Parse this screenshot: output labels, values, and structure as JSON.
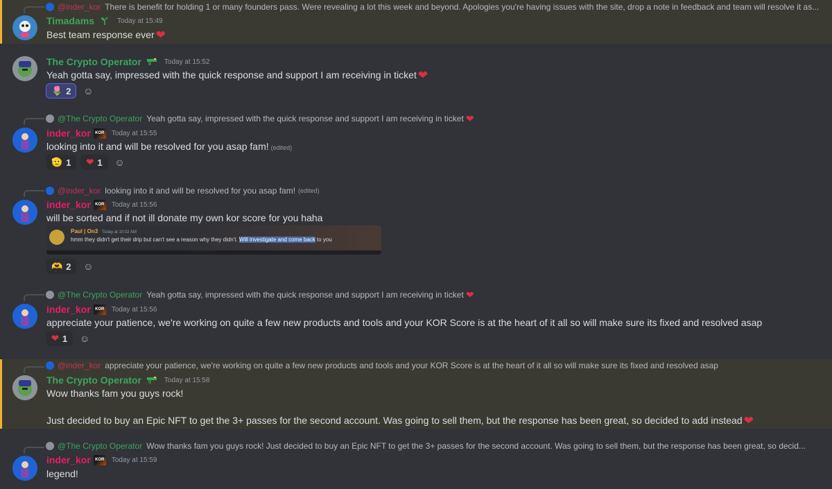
{
  "messages": [
    {
      "reply": {
        "name": "@inder_kor",
        "text": "There is benefit for holding 1 or many founders pass. Were revealing a lot this week and beyond.  Apologies you're having issues with the site, drop a note in feedback and team will resolve it as..."
      },
      "author": "Timadams",
      "timestamp": "Today at 15:49",
      "text": "Best team response ever"
    },
    {
      "author": "The Crypto Operator",
      "timestamp": "Today at 15:52",
      "text": "Yeah gotta say, impressed with the quick response and support I am receiving in ticket",
      "reactions": [
        {
          "emoji": "🌷",
          "count": "2"
        }
      ]
    },
    {
      "reply": {
        "name": "@The Crypto Operator",
        "text": "Yeah gotta say, impressed with the quick response and support I am receiving in ticket"
      },
      "author": "inder_kor",
      "badge": "KOR",
      "timestamp": "Today at 15:55",
      "text": "looking into it and will be resolved for you asap fam!",
      "edited": "(edited)",
      "reactions": [
        {
          "emoji": "🫡",
          "count": "1"
        },
        {
          "emoji": "❤",
          "count": "1"
        }
      ]
    },
    {
      "reply": {
        "name": "@inder_kor",
        "text": "looking into it and will be resolved for you asap fam!",
        "edited": "(edited)"
      },
      "author": "inder_kor",
      "badge": "KOR",
      "timestamp": "Today at 15:56",
      "text": "will be sorted and if not ill donate my own kor score for you haha",
      "embed": {
        "name": "Paul | On3",
        "timestamp": "Today at 10:02 AM",
        "text_plain": "hmm they didn't get their drip but can't see a reason why they didn't. ",
        "text_highlight": "Will investigate and come back",
        "text_end": " to you"
      },
      "reactions": [
        {
          "emoji": "🫶",
          "count": "2"
        }
      ]
    },
    {
      "reply": {
        "name": "@The Crypto Operator",
        "text": "Yeah gotta say, impressed with the quick response and support I am receiving in ticket"
      },
      "author": "inder_kor",
      "badge": "KOR",
      "timestamp": "Today at 15:56",
      "text": "appreciate your patience, we're working on quite a few new products and tools and your KOR Score is at the heart of it all so will make sure its fixed and resolved asap",
      "reactions": [
        {
          "emoji": "❤",
          "count": "1"
        }
      ]
    },
    {
      "reply": {
        "name": "@inder_kor",
        "text": "appreciate your patience, we're working on quite a few new products and tools and your KOR Score is at the heart of it all so will make sure its fixed and resolved asap"
      },
      "author": "The Crypto Operator",
      "timestamp": "Today at 15:58",
      "text": "Wow thanks fam you guys rock!",
      "text2": "Just decided to buy an Epic NFT to get the 3+ passes for the second account. Was going to sell them, but the response has been great, so decided to add instead"
    },
    {
      "reply": {
        "name": "@The Crypto Operator",
        "text": "Wow thanks fam you guys rock!  Just decided to buy an Epic NFT to get the 3+ passes for the second account. Was going to sell them, but the response has been great, so decid..."
      },
      "author": "inder_kor",
      "badge": "KOR",
      "timestamp": "Today at 15:59",
      "text": "legend!"
    }
  ],
  "colors": {
    "background": "#313338",
    "mention_bg": "#3b3a32",
    "mention_bar": "#f0b232",
    "green_name": "#3ba55c",
    "pink_name": "#e91e63",
    "heart": "#dd2e44"
  }
}
